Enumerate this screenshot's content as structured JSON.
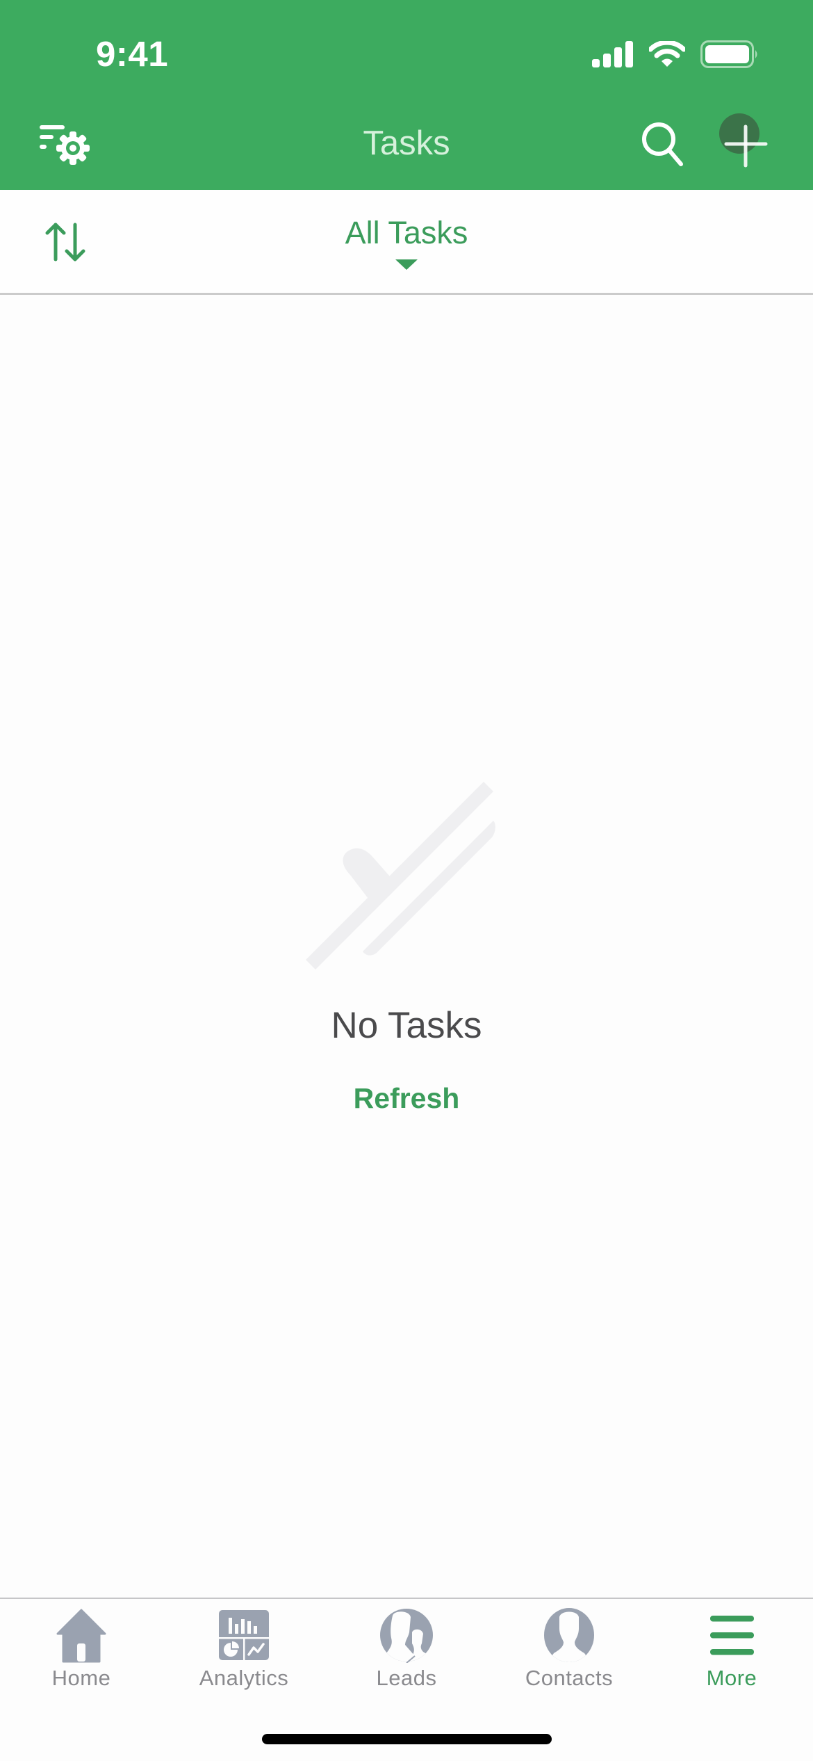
{
  "status_bar": {
    "time": "9:41",
    "icons": [
      "cellular-signal-icon",
      "wifi-icon",
      "battery-icon"
    ]
  },
  "nav_bar": {
    "title": "Tasks",
    "left_icon": "filter-settings-icon",
    "right_icons": [
      "search-icon",
      "plus-icon"
    ]
  },
  "subheader": {
    "sort_icon": "sort-arrows-icon",
    "filter_label": "All Tasks",
    "filter_caret": "caret-down-icon"
  },
  "empty_state": {
    "icon": "checkmark-icon",
    "title": "No Tasks",
    "action_label": "Refresh"
  },
  "tab_bar": {
    "active_index": 4,
    "items": [
      {
        "label": "Home",
        "icon": "home-icon"
      },
      {
        "label": "Analytics",
        "icon": "analytics-icon"
      },
      {
        "label": "Leads",
        "icon": "leads-icon"
      },
      {
        "label": "Contacts",
        "icon": "contacts-icon"
      },
      {
        "label": "More",
        "icon": "menu-icon"
      }
    ]
  },
  "colors": {
    "brand_green": "#3dab5f",
    "accent_green": "#3b9c5b",
    "title_mint": "#d6f1dc",
    "inactive_gray": "#9aa2b0",
    "empty_illustration": "#efeff1"
  }
}
